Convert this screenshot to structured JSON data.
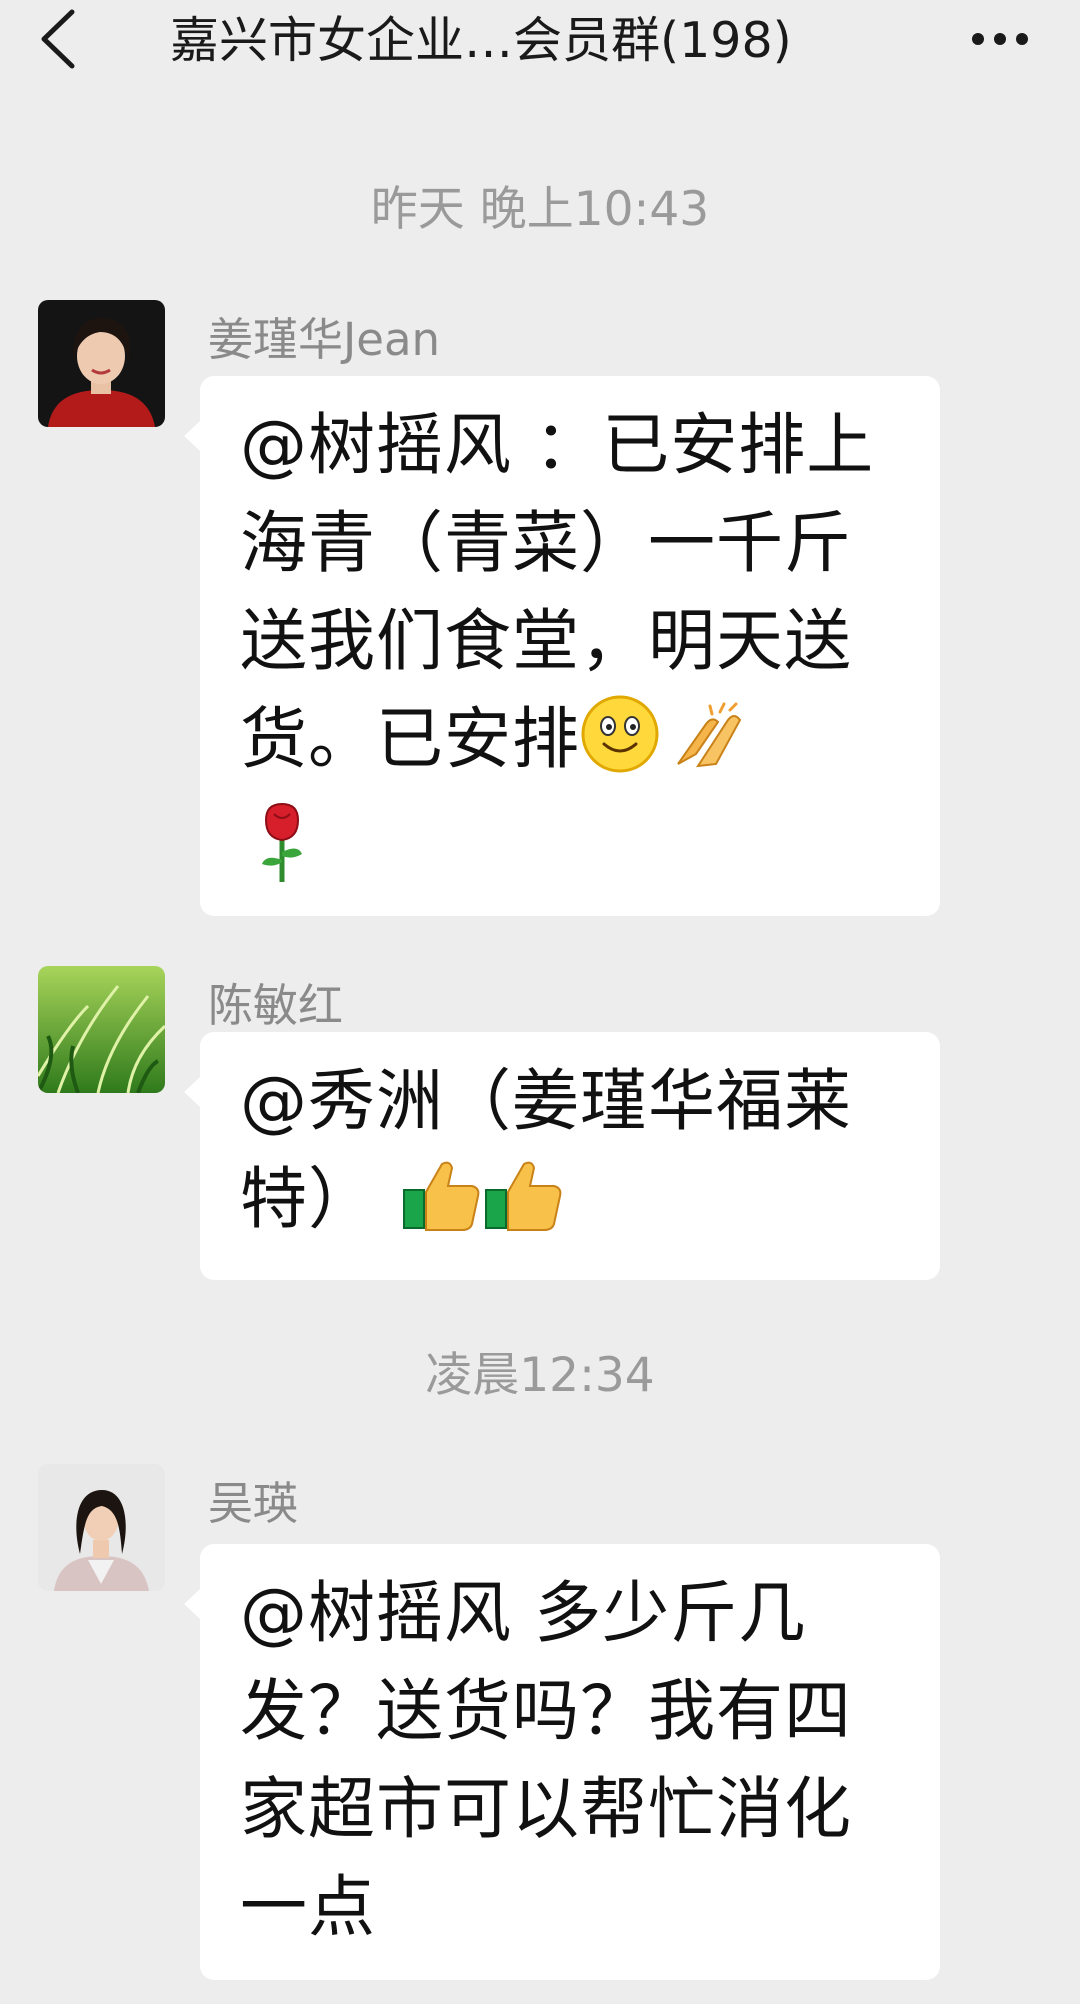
{
  "header": {
    "title": "嘉兴市女企业…会员群(198)",
    "back_icon": "chevron-left-icon",
    "more_icon": "ellipsis-icon"
  },
  "timestamps": [
    "昨天 晚上10:43",
    "凌晨12:34"
  ],
  "messages": [
    {
      "sender": "姜瑾华Jean",
      "text": "@树摇风 ：已安排上海青（青菜）一千斤送我们食堂，明天送货。已安排",
      "emojis": [
        "smile-emoji",
        "pray-hands-emoji",
        "rose-emoji"
      ]
    },
    {
      "sender": "陈敏红",
      "text": "@秀洲（姜瑾华福莱特）",
      "emojis": [
        "thumbs-up-emoji",
        "thumbs-up-emoji"
      ]
    },
    {
      "sender": "吴瑛",
      "text": "@树摇风 多少斤几发？送货吗？我有四家超市可以帮忙消化一点",
      "emojis": []
    }
  ],
  "colors": {
    "background": "#EDEDED",
    "bubble": "#FFFFFF",
    "timestamp": "#9A9A9A",
    "sender_name": "#8A8A8A"
  }
}
